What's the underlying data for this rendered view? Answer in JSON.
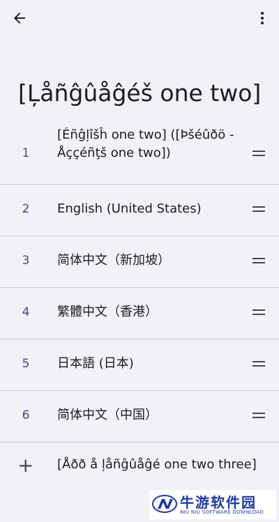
{
  "title": "[Ļåñĝûåĝéš one two]",
  "languages": [
    {
      "number": "1",
      "label": "[Éñĝļîšĥ one two] ([Þšéûðö - Åççéñţš one two])"
    },
    {
      "number": "2",
      "label": "English (United States)"
    },
    {
      "number": "3",
      "label": "简体中文（新加坡）"
    },
    {
      "number": "4",
      "label": "繁體中文（香港）"
    },
    {
      "number": "5",
      "label": "日本語 (日本)"
    },
    {
      "number": "6",
      "label": "简体中文（中国）"
    }
  ],
  "add_language": {
    "icon": "plus-icon",
    "label": "[Åðð å ļåñĝûåĝé one two three]"
  },
  "watermark": {
    "name": "牛游软件园",
    "subtitle": "NIU NIU SOFTWARE DOWNLOAD"
  },
  "colors": {
    "background": "#f2f1f6",
    "accent": "#3f4a8b",
    "divider": "#c6c5cb",
    "watermark": "#1f3a9c"
  }
}
